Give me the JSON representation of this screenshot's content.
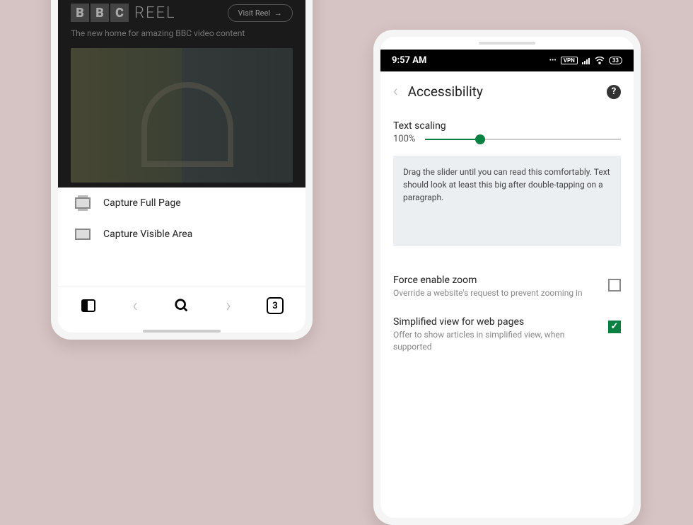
{
  "phone1": {
    "bbc": {
      "reel": "REEL",
      "visit_reel": "Visit Reel",
      "tagline": "The new home for amazing BBC video content"
    },
    "capture": {
      "full_page": "Capture Full Page",
      "visible_area": "Capture Visible Area"
    },
    "nav": {
      "tabs_count": "3"
    }
  },
  "phone2": {
    "status": {
      "time": "9:57 AM",
      "vpn": "VPN",
      "battery": "33"
    },
    "header": {
      "title": "Accessibility",
      "help": "?"
    },
    "text_scaling": {
      "label": "Text scaling",
      "value": "100%",
      "info": "Drag the slider until you can read this comfortably. Text should look at least this big after double-tapping on a paragraph."
    },
    "force_zoom": {
      "title": "Force enable zoom",
      "desc": "Override a website's request to prevent zooming in"
    },
    "simplified": {
      "title": "Simplified view for web pages",
      "desc": "Offer to show articles in simplified view, when supported"
    }
  }
}
